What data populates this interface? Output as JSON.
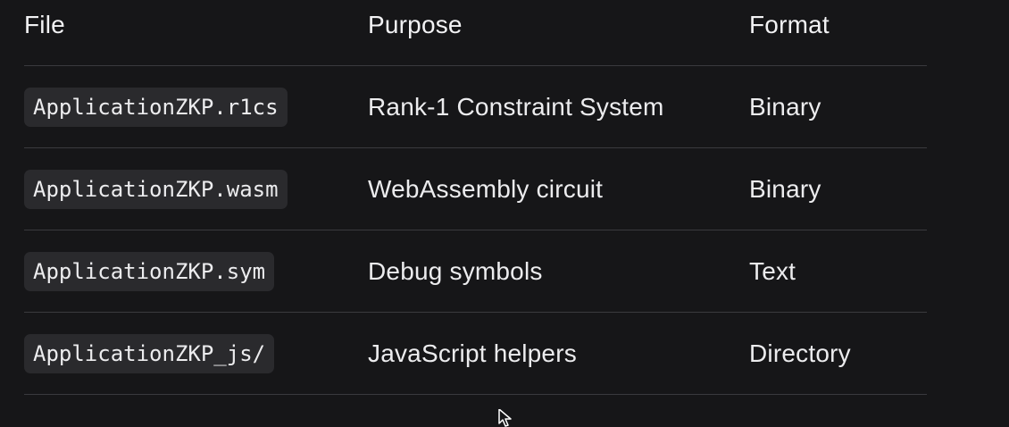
{
  "table": {
    "headers": [
      "File",
      "Purpose",
      "Format"
    ],
    "rows": [
      {
        "file": "ApplicationZKP.r1cs",
        "purpose": "Rank-1 Constraint System",
        "format": "Binary"
      },
      {
        "file": "ApplicationZKP.wasm",
        "purpose": "WebAssembly circuit",
        "format": "Binary"
      },
      {
        "file": "ApplicationZKP.sym",
        "purpose": "Debug symbols",
        "format": "Text"
      },
      {
        "file": "ApplicationZKP_js/",
        "purpose": "JavaScript helpers",
        "format": "Directory"
      }
    ]
  },
  "colors": {
    "background": "#161618",
    "code_background": "#2a2a2d",
    "divider": "#3a3a3e",
    "text": "#ececee"
  },
  "icons": {
    "cursor": "mouse-pointer-icon"
  }
}
